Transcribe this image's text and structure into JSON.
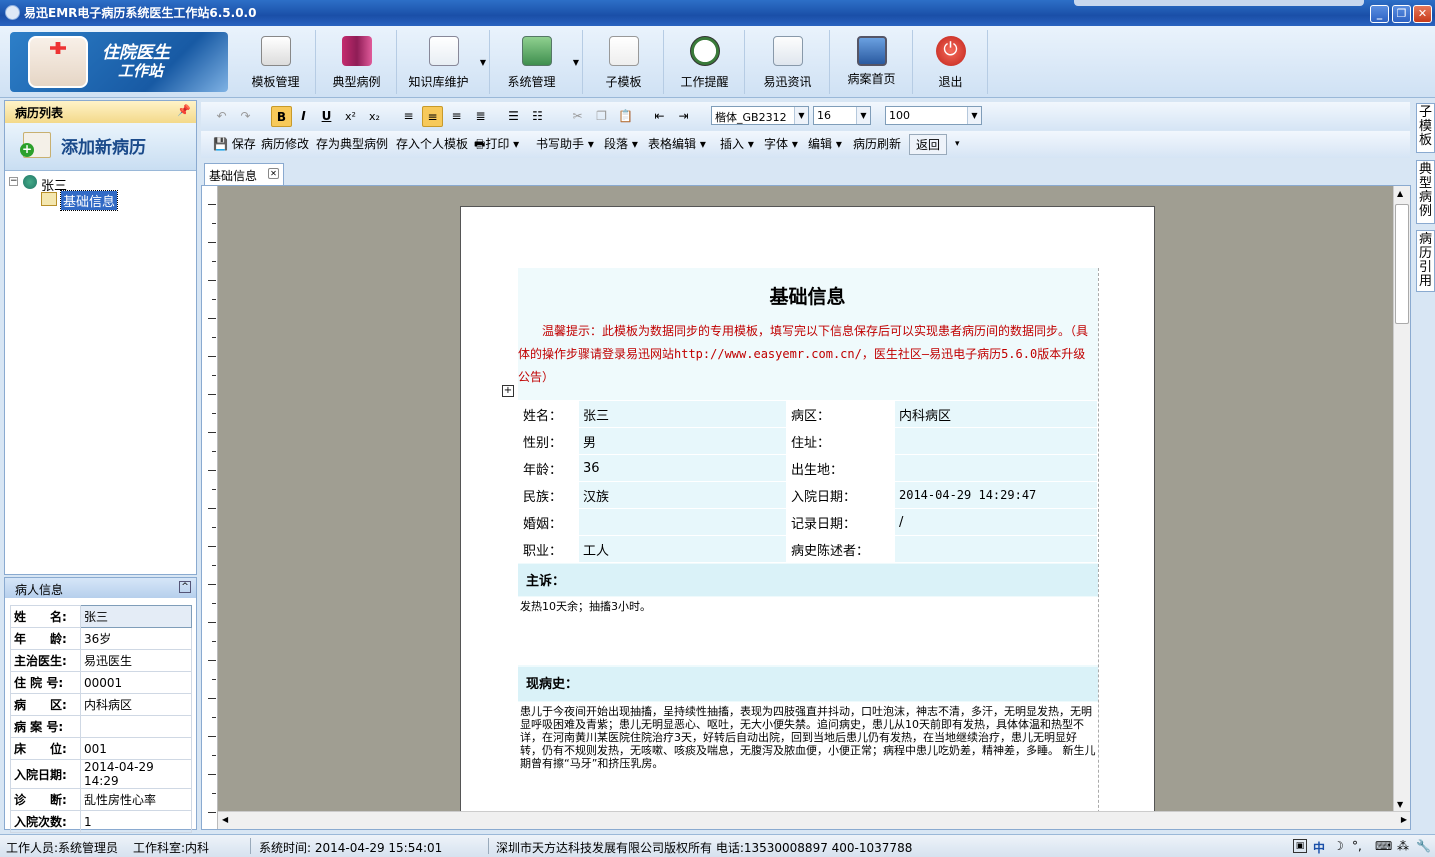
{
  "window": {
    "title": "易迅EMR电子病历系统医生工作站6.5.0.0"
  },
  "logo": {
    "line1": "住院医生",
    "line2": "工作站"
  },
  "toolbar": [
    {
      "label": "模板管理",
      "icon": "pencil-doc-icon",
      "dropdown": false
    },
    {
      "label": "典型病例",
      "icon": "books-icon",
      "dropdown": false
    },
    {
      "label": "知识库维护",
      "icon": "docs-icon",
      "dropdown": true
    },
    {
      "label": "系统管理",
      "icon": "monitor-icon",
      "dropdown": true
    },
    {
      "label": "子模板",
      "icon": "page-icon",
      "dropdown": false
    },
    {
      "label": "工作提醒",
      "icon": "clock-icon",
      "dropdown": false
    },
    {
      "label": "易迅资讯",
      "icon": "news-icon",
      "dropdown": false
    },
    {
      "label": "病案首页",
      "icon": "computer-icon",
      "dropdown": false
    },
    {
      "label": "退出",
      "icon": "power-icon",
      "dropdown": false
    }
  ],
  "left_panel": {
    "title": "病历列表",
    "add_label": "添加新病历",
    "tree": {
      "root": "张三",
      "child": "基础信息"
    }
  },
  "patient_panel": {
    "title": "病人信息",
    "rows": [
      {
        "k": "姓　　名:",
        "v": "张三"
      },
      {
        "k": "年　　龄:",
        "v": "36岁"
      },
      {
        "k": "主治医生:",
        "v": "易迅医生"
      },
      {
        "k": "住 院 号:",
        "v": "00001"
      },
      {
        "k": "病　　区:",
        "v": "内科病区"
      },
      {
        "k": "病 案 号:",
        "v": ""
      },
      {
        "k": "床　　位:",
        "v": "001"
      },
      {
        "k": "入院日期:",
        "v": "2014-04-29 14:29"
      },
      {
        "k": "诊　　断:",
        "v": "乱性房性心率"
      },
      {
        "k": "入院次数:",
        "v": "1"
      }
    ]
  },
  "format_bar": {
    "font": "楷体_GB2312",
    "size": "16",
    "zoom": "100"
  },
  "edit_bar": [
    "保存",
    "病历修改",
    "存为典型病例",
    "存入个人模板",
    "打印",
    "书写助手",
    "段落",
    "表格编辑",
    "插入",
    "字体",
    "编辑",
    "病历刷新",
    "返回"
  ],
  "doc_tab": "基础信息",
  "document": {
    "title": "基础信息",
    "tip": "　　温馨提示：此模板为数据同步的专用模板，填写完以下信息保存后可以实现患者病历间的数据同步。（具体的操作步骤请登录易迅网站http://www.easyemr.com.cn/，医生社区—易迅电子病历5.6.0版本升级公告）",
    "fields": [
      [
        "姓名：",
        "张三",
        "病区：",
        "内科病区"
      ],
      [
        "性别：",
        "男",
        "住址：",
        ""
      ],
      [
        "年龄：",
        "36",
        "出生地：",
        ""
      ],
      [
        "民族：",
        "汉族",
        "入院日期：",
        "2014-04-29 14:29:47"
      ],
      [
        "婚姻：",
        "",
        "记录日期：",
        "/"
      ],
      [
        "职业：",
        "工人",
        "病史陈述者：",
        ""
      ]
    ],
    "complaint_title": "主诉：",
    "complaint": "发热10天余；抽搐3小时。",
    "history_title": "现病史：",
    "history": "患儿于今夜间开始出现抽搐，呈持续性抽搐，表现为四肢强直并抖动，口吐泡沫，神志不清，多汗，无明显发热，无明显呼吸困难及青紫；患儿无明显恶心、呕吐，无大小便失禁。追问病史，患儿从10天前即有发热，具体体温和热型不详，在河南黄川某医院住院治疗3天，好转后自动出院，回到当地后患儿仍有发热，在当地继续治疗，患儿无明显好转，仍有不规则发热，无咳嗽、咳痰及喘息，无腹泻及脓血便，小便正常；病程中患儿吃奶差，精神差，多睡。 新生儿期曾有擦“马牙”和挤压乳房。"
  },
  "right_tabs": [
    "子模板",
    "典型病例",
    "病历引用"
  ],
  "status": {
    "user": "工作人员:系统管理员",
    "dept": "工作科室:内科",
    "time": "系统时间: 2014-04-29 15:54:01",
    "company": "深圳市天方达科技发展有限公司版权所有 电话:13530008897  400-1037788",
    "ime": "中"
  },
  "colors": {
    "accent": "#1a4fa8",
    "tip": "#c00000",
    "field_bg": "#e7f7fb",
    "section_bg": "#daf2f8"
  }
}
